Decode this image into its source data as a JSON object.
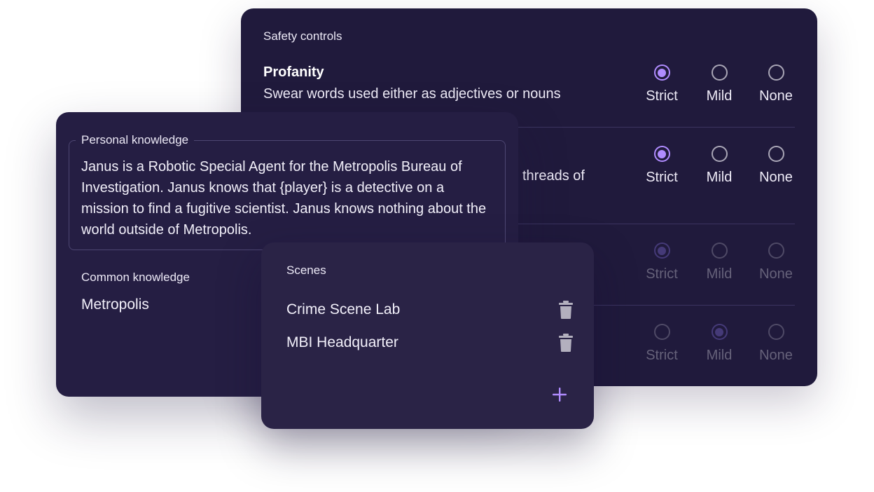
{
  "safety_controls": {
    "title": "Safety controls",
    "options": [
      "Strict",
      "Mild",
      "None"
    ],
    "rows": [
      {
        "name": "Profanity",
        "description": "Swear words used either as adjectives or nouns",
        "selected": "Strict",
        "enabled": true
      },
      {
        "name": "",
        "description": "threads of",
        "selected": "Strict",
        "enabled": true
      },
      {
        "name": "",
        "description": "",
        "selected": "Strict",
        "enabled": false
      },
      {
        "name": "",
        "description": "",
        "selected": "Mild",
        "enabled": false
      }
    ]
  },
  "knowledge": {
    "personal_label": "Personal knowledge",
    "personal_text": "Janus is a Robotic Special Agent for the Metropolis Bureau of Investigation. Janus knows that {player} is a detective on a mission to find a fugitive scientist. Janus knows nothing about the world outside of Metropolis.",
    "common_label": "Common knowledge",
    "common_value": "Metropolis"
  },
  "scenes": {
    "title": "Scenes",
    "items": [
      {
        "name": "Crime Scene Lab",
        "icon": "trash-icon"
      },
      {
        "name": "MBI Headquarter",
        "icon": "trash-icon"
      }
    ],
    "add_icon": "plus-icon"
  },
  "colors": {
    "panel_bg": "#201a3c",
    "accent": "#b08cff",
    "radio_off": "#a9a6b6"
  }
}
